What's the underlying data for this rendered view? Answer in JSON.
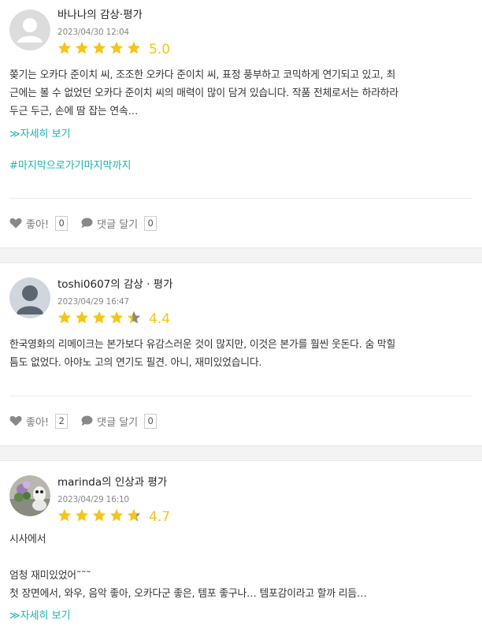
{
  "colors": {
    "accent": "#1ab2b0",
    "star": "#f5c518",
    "star_empty": "#888888"
  },
  "reviews": [
    {
      "title": "바나나의 감상·평가",
      "date": "2023/04/30 12:04",
      "rating": 5.0,
      "score": "5.0",
      "avatar": "default-user-icon",
      "text_lines": [
        "쫒기는 오카다 준이치 씨, 조조한 오카다 준이치 씨, 표정 풍부하고 코믹하게 연기되고 있고, 최",
        "근에는 볼 수 없었던 오카다 준이치 씨의 매력이 많이 담겨 있습니다. 작품 전체로서는 하라하라",
        "두근 두근, 손에 땀 잡는 연속…"
      ],
      "more": "≫자세히 보기",
      "tag": "#마지막으로가기마지막까지",
      "like_label": "좋아!",
      "like_count": "0",
      "comment_label": "댓글 달기",
      "comment_count": "0"
    },
    {
      "title": "toshi0607의 감상 · 평가",
      "date": "2023/04/29 16:47",
      "rating": 4.4,
      "score": "4.4",
      "avatar": "user-silhouette-icon",
      "text_lines": [
        "한국영화의 리메이크는 본가보다 유감스러운 것이 많지만, 이것은 본가를 훨씬 웃돈다. 숨 막힐",
        "틈도 없었다. 아야노 고의 연기도 필견. 아니, 재미있었습니다."
      ],
      "like_label": "좋아!",
      "like_count": "2",
      "comment_label": "댓글 달기",
      "comment_count": "0"
    },
    {
      "title": "marinda의 인상과 평가",
      "date": "2023/04/29 16:10",
      "rating": 4.7,
      "score": "4.7",
      "avatar": "flower-photo-avatar",
      "text_lines": [
        "시사에서",
        "",
        "엄청 재미있었어˜˜˜",
        "첫 장면에서, 와우, 음악 좋아, 오카다군 좋은, 템포 좋구나… 템포감이라고 할까 리듬…"
      ],
      "more": "≫자세히 보기"
    }
  ]
}
